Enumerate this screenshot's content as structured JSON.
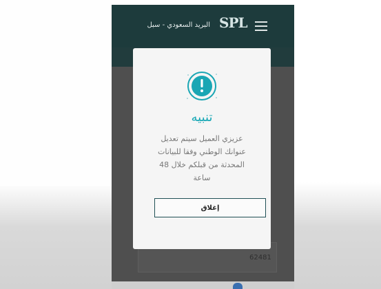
{
  "header": {
    "brand_text": "البريد السعودي - سبل",
    "logo_text": "SPL",
    "menu_icon": "hamburger-menu-icon"
  },
  "modal": {
    "icon": "alert-exclamation-icon",
    "title": "تنبيه",
    "message_lines": [
      "عزيزي العميل سيتم تعديل",
      "عنوانك الوطني وفقا للبيانات",
      "المحدثة من قبلكم خلال 48",
      "ساعة"
    ],
    "close_label": "إغلاق"
  },
  "form": {
    "field_value": "62481"
  },
  "colors": {
    "header": "#1d3b3c",
    "accent": "#16a7b5",
    "button_border": "#1f4f55"
  }
}
